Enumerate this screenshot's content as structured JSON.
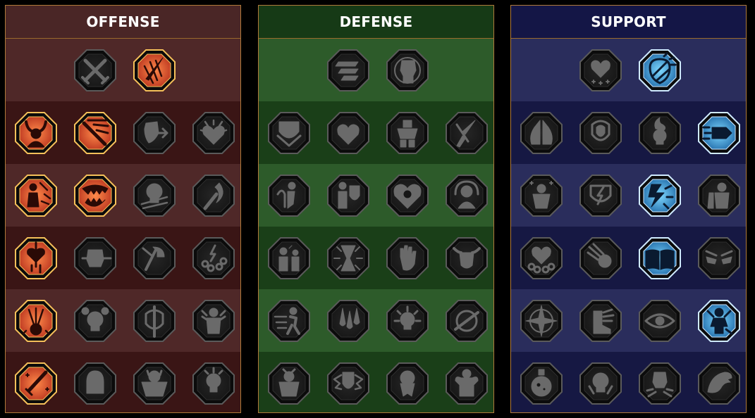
{
  "panels": [
    {
      "id": "offense",
      "title": "OFFENSE",
      "rows": [
        [
          {
            "icon": "crossed-swords-icon",
            "state": "inactive"
          },
          {
            "icon": "dagger-slash-icon",
            "state": "active-red"
          }
        ],
        [
          {
            "icon": "demon-horns-icon",
            "state": "active-red"
          },
          {
            "icon": "sword-streaks-icon",
            "state": "active-red"
          },
          {
            "icon": "shield-arrow-icon",
            "state": "inactive"
          },
          {
            "icon": "spiked-heart-icon",
            "state": "inactive"
          }
        ],
        [
          {
            "icon": "arrows-in-body-icon",
            "state": "active-red"
          },
          {
            "icon": "fanged-maw-icon",
            "state": "active-red"
          },
          {
            "icon": "skull-dash-icon",
            "state": "inactive"
          },
          {
            "icon": "sickle-icon",
            "state": "inactive"
          }
        ],
        [
          {
            "icon": "bleeding-heart-icon",
            "state": "active-red"
          },
          {
            "icon": "fist-icon",
            "state": "inactive"
          },
          {
            "icon": "axe-icon",
            "state": "inactive"
          },
          {
            "icon": "chain-lightning-icon",
            "state": "inactive"
          }
        ],
        [
          {
            "icon": "triple-arrows-icon",
            "state": "active-red"
          },
          {
            "icon": "horned-skull-icon",
            "state": "inactive"
          },
          {
            "icon": "spear-shield-icon",
            "state": "inactive"
          },
          {
            "icon": "barbarian-icon",
            "state": "inactive"
          }
        ],
        [
          {
            "icon": "sparkling-sword-icon",
            "state": "active-red"
          },
          {
            "icon": "knight-helm-icon",
            "state": "inactive"
          },
          {
            "icon": "ogre-icon",
            "state": "inactive"
          },
          {
            "icon": "skull-mace-icon",
            "state": "inactive"
          }
        ]
      ]
    },
    {
      "id": "defense",
      "title": "DEFENSE",
      "rows": [
        [
          {
            "icon": "armor-plates-icon",
            "state": "inactive"
          },
          {
            "icon": "raised-fist-icon",
            "state": "inactive"
          }
        ],
        [
          {
            "icon": "layered-shield-icon",
            "state": "inactive"
          },
          {
            "icon": "armored-heart-icon",
            "state": "inactive"
          },
          {
            "icon": "stone-golem-icon",
            "state": "inactive"
          },
          {
            "icon": "broken-blade-icon",
            "state": "inactive"
          }
        ],
        [
          {
            "icon": "dodging-figure-icon",
            "state": "inactive"
          },
          {
            "icon": "knight-shield-icon",
            "state": "inactive"
          },
          {
            "icon": "skull-heart-icon",
            "state": "inactive"
          },
          {
            "icon": "aura-head-icon",
            "state": "inactive"
          }
        ],
        [
          {
            "icon": "cheering-crowd-icon",
            "state": "inactive"
          },
          {
            "icon": "hourglass-icon",
            "state": "inactive"
          },
          {
            "icon": "open-palm-icon",
            "state": "inactive"
          },
          {
            "icon": "bull-icon",
            "state": "inactive"
          }
        ],
        [
          {
            "icon": "dashing-runner-icon",
            "state": "inactive"
          },
          {
            "icon": "claw-drops-icon",
            "state": "inactive"
          },
          {
            "icon": "spiked-skull-icon",
            "state": "inactive"
          },
          {
            "icon": "parry-slash-icon",
            "state": "inactive"
          }
        ],
        [
          {
            "icon": "warlord-icon",
            "state": "inactive"
          },
          {
            "icon": "winged-shield-icon",
            "state": "inactive"
          },
          {
            "icon": "bearded-skull-icon",
            "state": "inactive"
          },
          {
            "icon": "strongman-icon",
            "state": "inactive"
          }
        ]
      ]
    },
    {
      "id": "support",
      "title": "SUPPORT",
      "rows": [
        [
          {
            "icon": "heart-plus-icon",
            "state": "inactive"
          },
          {
            "icon": "shattered-shield-icon",
            "state": "active-blue"
          }
        ],
        [
          {
            "icon": "praying-hands-icon",
            "state": "inactive"
          },
          {
            "icon": "concentric-shield-icon",
            "state": "inactive"
          },
          {
            "icon": "flaming-skull-icon",
            "state": "inactive"
          },
          {
            "icon": "speeding-arrow-icon",
            "state": "active-blue"
          }
        ],
        [
          {
            "icon": "blessed-figure-icon",
            "state": "inactive"
          },
          {
            "icon": "lightning-shield-icon",
            "state": "inactive"
          },
          {
            "icon": "shattering-icon",
            "state": "active-blue"
          },
          {
            "icon": "shadow-figures-icon",
            "state": "inactive"
          }
        ],
        [
          {
            "icon": "chained-heart-icon",
            "state": "inactive"
          },
          {
            "icon": "comet-icon",
            "state": "inactive"
          },
          {
            "icon": "open-book-icon",
            "state": "active-blue"
          },
          {
            "icon": "angry-eyes-icon",
            "state": "inactive"
          }
        ],
        [
          {
            "icon": "compass-star-icon",
            "state": "inactive"
          },
          {
            "icon": "winged-boot-icon",
            "state": "inactive"
          },
          {
            "icon": "all-seeing-eye-icon",
            "state": "inactive"
          },
          {
            "icon": "voodoo-doll-icon",
            "state": "active-blue"
          }
        ],
        [
          {
            "icon": "poison-flask-icon",
            "state": "inactive"
          },
          {
            "icon": "cursed-skull-icon",
            "state": "inactive"
          },
          {
            "icon": "fist-blast-icon",
            "state": "inactive"
          },
          {
            "icon": "eagle-icon",
            "state": "inactive"
          }
        ]
      ]
    }
  ],
  "colors": {
    "inactive_fill": "#161616",
    "inactive_border": "#5a5a5a",
    "inactive_glyph": "#6a6a6a",
    "red_fill": "#b8321e",
    "red_fill_center": "#ff8a4a",
    "red_border": "#f5c05a",
    "red_glyph": "#2a0a06",
    "blue_fill": "#1f6aa8",
    "blue_fill_center": "#7fd8ff",
    "blue_border": "#cfeaff",
    "blue_glyph": "#0a1a30"
  }
}
